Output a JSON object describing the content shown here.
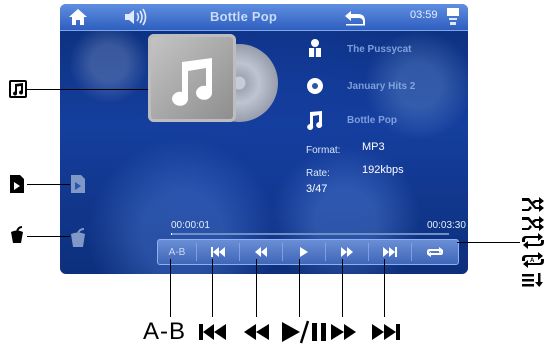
{
  "status_bar": {
    "title": "Bottle Pop",
    "time": "03:59",
    "icons": [
      "home-icon",
      "volume-icon",
      "back-icon",
      "usb-icon"
    ]
  },
  "song_info": {
    "artist": "The Pussycat",
    "album": "January Hits 2",
    "title": "Bottle Pop",
    "format_label": "Format:",
    "format_value": "MP3",
    "rate_label": "Rate:",
    "rate_value": "192kbps",
    "track": "3/47"
  },
  "playback": {
    "elapsed": "00:00:01",
    "total": "00:03:30",
    "progress_fraction": 0.005,
    "ab_label": "A-B"
  },
  "callouts": {
    "ab": "A-B",
    "prev": "⏮",
    "rewind": "⏪",
    "play_pause": "▶/II",
    "forward": "⏩",
    "next": "⏭"
  },
  "colors": {
    "screen_bg": "#153f9e",
    "status_bar": "#4a7bd4",
    "control_bar": "#5478c7"
  }
}
